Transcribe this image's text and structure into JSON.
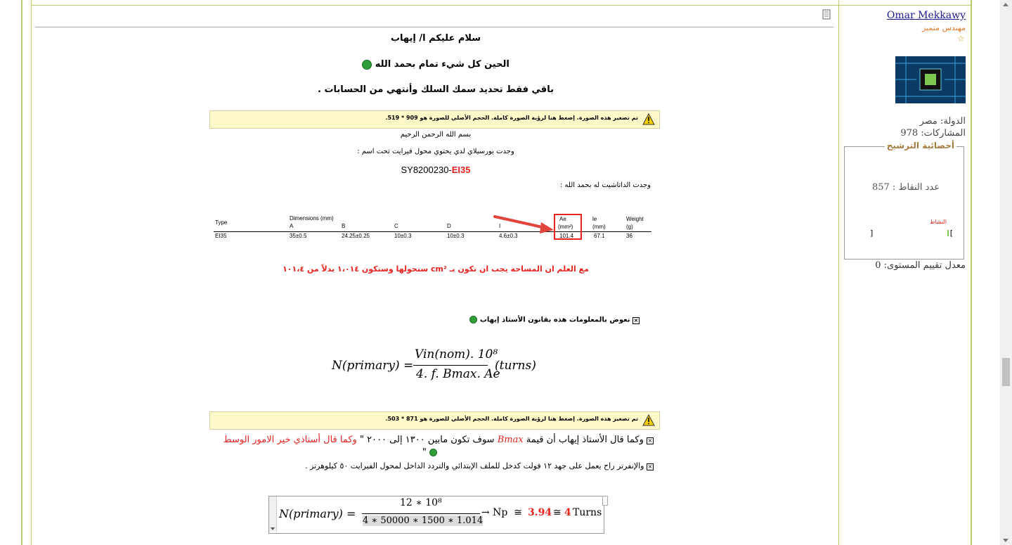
{
  "sidebar": {
    "username": "Omar Mekkawy",
    "user_title": "مهندس متميز",
    "country_label": "الدولة:",
    "country_value": "مصر",
    "posts_label": "المشاركات:",
    "posts_value": "978",
    "rep_box_title": "أحصائية الترشيح",
    "points_label": "عدد النقاط :",
    "points_value": "857",
    "activity_label": "النشاط",
    "rating_label": "معدل تقييم المستوى:",
    "rating_value": "0"
  },
  "post": {
    "greeting": "سلام عليكم ا/ إيهاب",
    "line2": "الحين كل شيء تمام بحمد الله",
    "line3": "باقي فقط تحديد سمك السلك وأنتهي من الحسابات .",
    "warn1": "تم تصغير هذه الصورة. إضغط هنا لرؤية الصورة كاملة. الحجم الأصلي للصورة هو 909 * 519.",
    "img_bismillah": "بسم الله الرحمن الرحيم",
    "img_found": "وجدت بورسيلاي لدي يحتوي محول فيرايت تحت اسم :",
    "core_part_a": "SY8200230-",
    "core_part_b": "EI35",
    "datasheet_line": "وجدت الداتاشيت له بحمد الله :",
    "table": {
      "type_h": "Type",
      "dims_h": "Dimensions (mm)",
      "a": "A",
      "b": "B",
      "c": "C",
      "d": "D",
      "i": "I",
      "ae_h1": "Ae",
      "ae_h2": "(mm²)",
      "le_h1": "le",
      "le_h2": "(mm)",
      "w_h1": "Weight",
      "w_h2": "(g)",
      "row_type": "EI35",
      "row_a": "35±0.5",
      "row_b": "24.25±0.25",
      "row_c": "10±0.3",
      "row_d": "10±0.3",
      "row_i": "4.6±0.3",
      "row_ae": "101.4",
      "row_le": "67.1",
      "row_w": "36"
    },
    "red_note": "مع العلم ان المساحة يجب ان تكون بـ cm² سنحولها وستكون ١،٠١٤ بدلاً من ١٠١،٤",
    "substitute_line": "نعوض بالمعلومات هذه بقانون الأستاذ إيهاب",
    "formula1": {
      "lhs": "N(primary) =",
      "num": "Vin(nom). 10⁸",
      "den": "4. f. Bmax. Ae",
      "rhs": "(turns)"
    },
    "warn2": "تم تصغير هذه الصورة. إضغط هنا لرؤية الصورة كاملة. الحجم الأصلي للصورة هو 871 * 503.",
    "bmax_line_a": "وكما قال الأستاذ إيهاب أن قيمة",
    "bmax_var": "Bmax",
    "bmax_line_b": "سوف تكون مابين ١٣٠٠ إلى ٢٠٠٠ \"",
    "bmax_line_red": "وكما قال أستاذي خير الامور الوسط",
    "bmax_quote_end": "\"",
    "inverter_line": "والإنفرتر راح يعمل على جهد ١٢ فولت كدخل للملف الإبتدائي والتردد الداخل لمحول الفيرايت ٥٠ كيلوهرتز .",
    "formula2": {
      "lhs": "N(primary) =",
      "num": "12 ∗ 10⁸",
      "den": "4 ∗ 50000 ∗ 1500 ∗ 1.014",
      "arrow": "→ Np  ≅",
      "v1": "3.94",
      "approx": "≅",
      "v2": "4",
      "unit": "Turns"
    }
  },
  "colors": {
    "border": "#b7cf6b",
    "red": "#e8231f",
    "warn_bg": "#fdf9c8",
    "user_title": "#e87d2b",
    "rep_title": "#a67c3d"
  }
}
